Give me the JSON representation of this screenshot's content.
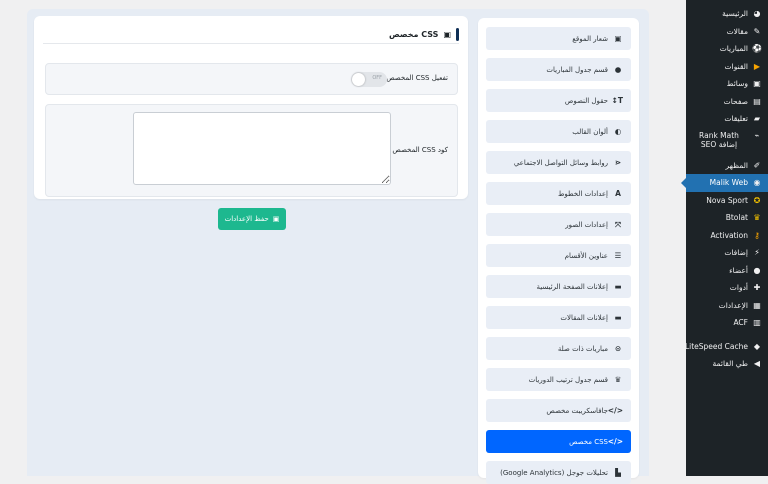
{
  "admin_menu": [
    {
      "id": "dashboard",
      "label": "الرئيسية",
      "icon": "◕",
      "icon_name": "dashboard-icon"
    },
    {
      "id": "posts",
      "label": "مقالات",
      "icon": "✎",
      "icon_name": "pin-icon"
    },
    {
      "id": "matches",
      "label": "المباريات",
      "icon": "⚽",
      "icon_name": "soccer-icon",
      "accent": "yellow"
    },
    {
      "id": "channels",
      "label": "القنوات",
      "icon": "▶",
      "icon_name": "play-icon",
      "accent": "orange"
    },
    {
      "id": "media",
      "label": "وسائط",
      "icon": "▣",
      "icon_name": "media-icon"
    },
    {
      "id": "pages",
      "label": "صفحات",
      "icon": "▤",
      "icon_name": "page-icon"
    },
    {
      "id": "comments",
      "label": "تعليقات",
      "icon": "▰",
      "icon_name": "comment-icon"
    },
    {
      "id": "rankmath",
      "label": "Rank Math إضافة SEO",
      "icon": "⌁",
      "icon_name": "chart-icon",
      "tall": true
    },
    {
      "id": "appearance",
      "label": "المظهر",
      "icon": "✐",
      "icon_name": "brush-icon"
    },
    {
      "id": "malikweb",
      "label": "Malik Web",
      "icon": "◉",
      "icon_name": "malik-web-icon",
      "active": true
    },
    {
      "id": "novasport",
      "label": "Nova Sport",
      "icon": "✪",
      "icon_name": "star-icon",
      "accent": "yellow"
    },
    {
      "id": "btolat",
      "label": "Btolat",
      "icon": "♛",
      "icon_name": "trophy-icon",
      "accent": "yellow"
    },
    {
      "id": "activation",
      "label": "Activation",
      "icon": "⚷",
      "icon_name": "key-icon",
      "accent": "orange"
    },
    {
      "id": "plugins",
      "label": "إضافات",
      "icon": "⚡",
      "icon_name": "plugin-icon"
    },
    {
      "id": "users",
      "label": "أعضاء",
      "icon": "●",
      "icon_name": "user-icon"
    },
    {
      "id": "tools",
      "label": "أدوات",
      "icon": "✚",
      "icon_name": "wrench-icon"
    },
    {
      "id": "settings",
      "label": "الإعدادات",
      "icon": "▦",
      "icon_name": "settings-icon"
    },
    {
      "id": "acf",
      "label": "ACF",
      "icon": "▥",
      "icon_name": "acf-icon"
    },
    {
      "id": "litespeed",
      "label": "LiteSpeed Cache",
      "icon": "◆",
      "icon_name": "diamond-icon",
      "gap_before": true
    },
    {
      "id": "collapse",
      "label": "طي القائمة",
      "icon": "◀",
      "icon_name": "collapse-icon"
    }
  ],
  "tabs": [
    {
      "id": "logo",
      "label": "شعار الموقع",
      "icon": "▣",
      "icon_name": "image-icon"
    },
    {
      "id": "match-table",
      "label": "قسم جدول المباريات",
      "icon": "●",
      "icon_name": "clock-icon"
    },
    {
      "id": "text-fields",
      "label": "حقول النصوص",
      "icon": "T↕",
      "icon_name": "text-height-icon"
    },
    {
      "id": "colors",
      "label": "ألوان القالب",
      "icon": "◐",
      "icon_name": "palette-icon"
    },
    {
      "id": "social",
      "label": "روابط وسائل التواصل الاجتماعي",
      "icon": "⋖",
      "icon_name": "share-icon"
    },
    {
      "id": "fonts",
      "label": "إعدادات الخطوط",
      "icon": "A",
      "icon_name": "font-icon"
    },
    {
      "id": "images",
      "label": "إعدادات الصور",
      "icon": "⤧",
      "icon_name": "expand-icon"
    },
    {
      "id": "section-titles",
      "label": "عناوين الأقسام",
      "icon": "☰",
      "icon_name": "list-icon"
    },
    {
      "id": "home-ads",
      "label": "إعلانات الصفحة الرئيسية",
      "icon": "▬",
      "icon_name": "ad-icon"
    },
    {
      "id": "post-ads",
      "label": "إعلانات المقالات",
      "icon": "▬",
      "icon_name": "ad-icon"
    },
    {
      "id": "related",
      "label": "مباريات ذات صلة",
      "icon": "⊙",
      "icon_name": "soccer-ball-icon"
    },
    {
      "id": "standings",
      "label": "قسم جدول ترتيب الدوريات",
      "icon": "♛",
      "icon_name": "trophy-icon"
    },
    {
      "id": "custom-js",
      "label": "جافاسكريبت مخصص",
      "icon": "</>",
      "icon_name": "code-icon"
    },
    {
      "id": "custom-css",
      "label": "CSS مخصص",
      "icon": "</>",
      "icon_name": "code-icon",
      "active": true
    },
    {
      "id": "analytics",
      "label": "تحليلات جوجل (Google Analytics)",
      "icon": "▙",
      "icon_name": "analytics-icon"
    }
  ],
  "card": {
    "title": "CSS مخصص",
    "title_icon": "▣",
    "toggle_label": "تفعيل CSS المخصص",
    "toggle_state": "OFF",
    "code_label": "كود CSS المخصص",
    "code_value": ""
  },
  "save_button": {
    "label": "حفظ الإعدادات",
    "icon": "▣"
  },
  "colors": {
    "active_tab": "#0066ff",
    "save_button": "#1db88f",
    "admin_active": "#2271b1",
    "admin_bg": "#1d2327"
  }
}
